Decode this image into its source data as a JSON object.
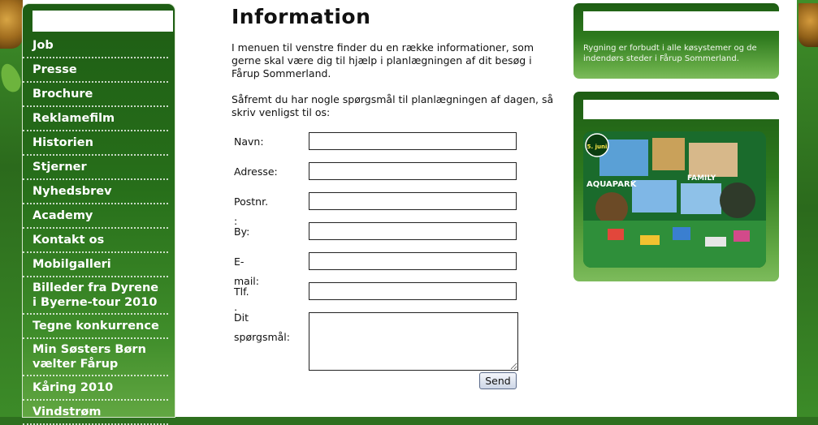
{
  "nav": {
    "items": [
      {
        "label": "Job"
      },
      {
        "label": "Presse"
      },
      {
        "label": "Brochure"
      },
      {
        "label": "Reklamefilm"
      },
      {
        "label": "Historien"
      },
      {
        "label": "Stjerner"
      },
      {
        "label": "Nyhedsbrev"
      },
      {
        "label": "Academy"
      },
      {
        "label": "Kontakt os"
      },
      {
        "label": "Mobilgalleri"
      },
      {
        "label": "Billeder fra Dyrene i Byerne-tour 2010"
      },
      {
        "label": "Tegne konkurrence"
      },
      {
        "label": "Min Søsters Børn vælter Fårup"
      },
      {
        "label": "Kåring 2010"
      },
      {
        "label": "Vindstrøm"
      }
    ]
  },
  "main": {
    "title": "Information",
    "paragraph1": "I menuen til venstre finder du en række informationer, som gerne skal være dig til hjælp i planlægningen af dit besøg i Fårup Sommerland.",
    "paragraph2": "Såfremt du har nogle spørgsmål til planlægningen af dagen, så skriv venligst til os:"
  },
  "form": {
    "fields": [
      {
        "label": "Navn:",
        "value": ""
      },
      {
        "label": "Adresse:",
        "value": ""
      },
      {
        "label": "Postnr. :",
        "value": ""
      },
      {
        "label": "By:",
        "value": ""
      },
      {
        "label": "E-mail:",
        "value": ""
      },
      {
        "label": "Tlf. :",
        "value": ""
      }
    ],
    "question_label": "Dit spørgsmål:",
    "question_value": "",
    "send_label": "Send"
  },
  "right": {
    "smoking_notice": "Rygning er forbudt i alle køsystemer og de indendørs steder i Fårup Sommerland.",
    "promo_badge": "5. juni",
    "promo_text_left": "AQUAPARK",
    "promo_text_right": "FAMILY"
  },
  "colors": {
    "nav_dark_green": "#1e5d14",
    "nav_light_green": "#62a742",
    "page_background": "#2e6f1f"
  }
}
